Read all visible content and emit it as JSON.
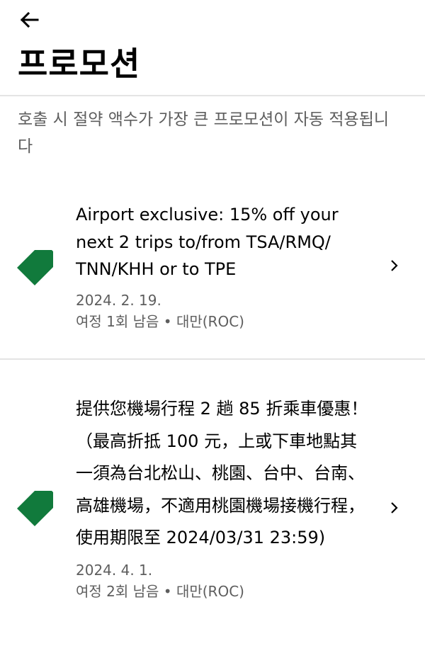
{
  "header": {
    "back_icon": "arrow-left-icon",
    "title": "프로모션"
  },
  "subtitle": "호출 시 절약 액수가 가장 큰 프로모션이 자동 적용됩니다",
  "promotions": [
    {
      "icon": "tag-icon",
      "title": "Airport exclusive: 15% off your next 2 trips to/from TSA/RMQ/ TNN/KHH or to TPE",
      "date": "2024. 2. 19.",
      "details": "여정 1회 남음 • 대만(ROC)"
    },
    {
      "icon": "tag-icon",
      "title": "提供您機場行程 2 趟 85 折乘車優惠！（最高折抵 100 元，上或下車地點其一須為台北松山、桃園、台中、台南、高雄機場，不適用桃園機場接機行程，使用期限至 2024/03/31 23:59)",
      "date": "2024. 4. 1.",
      "details": "여정 2회 남음 • 대만(ROC)"
    }
  ],
  "colors": {
    "tag": "#117a3c",
    "secondary_text": "#5e5e5e",
    "divider": "#e4e4e4"
  }
}
